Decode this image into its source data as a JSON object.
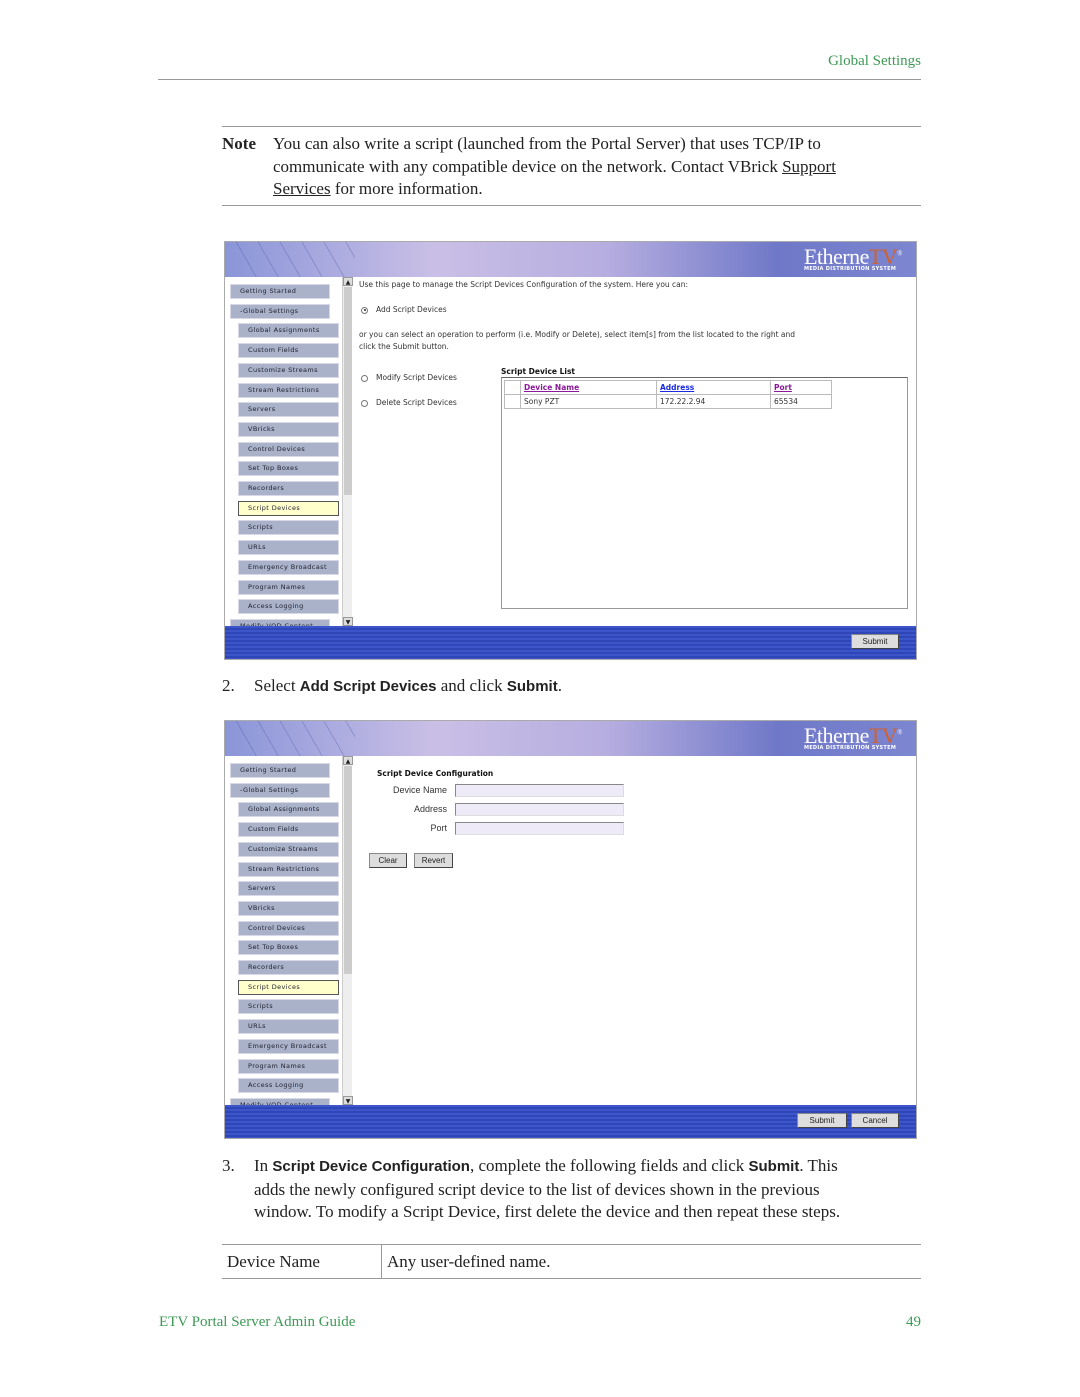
{
  "header": {
    "section": "Global Settings"
  },
  "note": {
    "label": "Note",
    "text1": "You can also write a script (launched from the Portal Server) that uses TCP/IP to",
    "text2": "communicate with any compatible device on the network. Contact VBrick ",
    "link1": "Support ",
    "link2": "Services",
    "text3": " for more information."
  },
  "app": {
    "logo_main": "Etherne",
    "logo_tv": "TV",
    "logo_reg": "®",
    "logo_sub": "MEDIA DISTRIBUTION SYSTEM",
    "nav": [
      {
        "label": "Getting Started",
        "level": 0
      },
      {
        "label": "-Global Settings",
        "level": 0
      },
      {
        "label": "Global Assignments",
        "level": 1
      },
      {
        "label": "Custom Fields",
        "level": 1
      },
      {
        "label": "Customize Streams",
        "level": 1
      },
      {
        "label": "Stream Restrictions",
        "level": 1
      },
      {
        "label": "Servers",
        "level": 1
      },
      {
        "label": "VBricks",
        "level": 1
      },
      {
        "label": "Control Devices",
        "level": 1
      },
      {
        "label": "Set Top Boxes",
        "level": 1
      },
      {
        "label": "Recorders",
        "level": 1
      },
      {
        "label": "Script Devices",
        "level": 1,
        "selected": true
      },
      {
        "label": "Scripts",
        "level": 1
      },
      {
        "label": "URLs",
        "level": 1
      },
      {
        "label": "Emergency Broadcast",
        "level": 1
      },
      {
        "label": "Program Names",
        "level": 1
      },
      {
        "label": "Access Logging",
        "level": 1
      },
      {
        "label": "Modify VOD Content",
        "level": 0
      }
    ]
  },
  "shot1": {
    "intro": "Use this page to manage the Script Devices Configuration of the system. Here you can:",
    "add": "Add Script Devices",
    "or_text": "or you can select an operation to perform (i.e. Modify or Delete), select item[s] from the list located to the right and",
    "or_text2": "click the Submit button.",
    "modify": "Modify Script Devices",
    "delete": "Delete Script Devices",
    "list_title": "Script Device List",
    "columns": [
      "Device Name",
      "Address",
      "Port"
    ],
    "rows": [
      [
        "Sony PZT",
        "172.22.2.94",
        "65534"
      ]
    ],
    "submit": "Submit"
  },
  "step2": {
    "num": "2.",
    "pre": "Select ",
    "bold1": "Add Script Devices",
    "mid": " and click ",
    "bold2": "Submit",
    "post": "."
  },
  "shot2": {
    "title": "Script Device Configuration",
    "fields": [
      {
        "label": "Device Name",
        "value": ""
      },
      {
        "label": "Address",
        "value": ""
      },
      {
        "label": "Port",
        "value": ""
      }
    ],
    "clear": "Clear",
    "revert": "Revert",
    "submit": "Submit",
    "cancel": "Cancel"
  },
  "step3": {
    "num": "3.",
    "pre": "In ",
    "bold1": "Script Device Configuration",
    "mid": ", complete the following fields and click ",
    "bold2": "Submit",
    "post": ". This",
    "line2": "adds the newly configured script device to the list of devices shown in the previous",
    "line3": "window. To modify a Script Device, first delete the device and then repeat these steps."
  },
  "table": {
    "rows": [
      [
        "Device Name",
        "Any user-defined name."
      ]
    ]
  },
  "footer": {
    "title": "ETV Portal Server Admin Guide",
    "page": "49"
  },
  "colors": {
    "accent_green": "#3d9a55",
    "nav_selected": "#ffffcc",
    "footer_bar": "#3c55c8"
  }
}
